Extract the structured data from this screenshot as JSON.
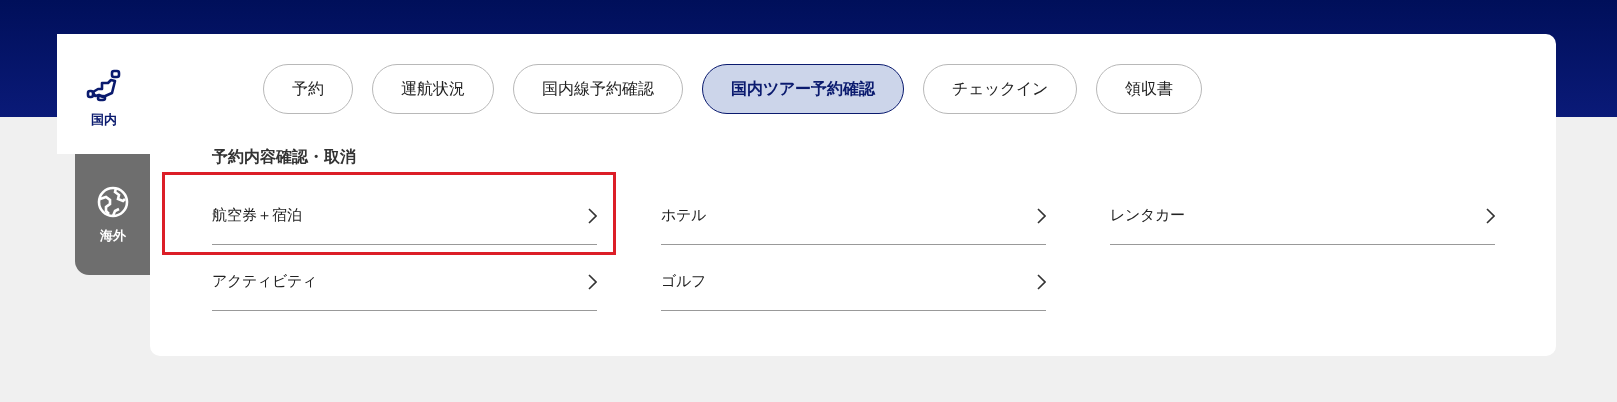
{
  "side_tabs": [
    {
      "label": "国内",
      "kind": "japan",
      "selected": true
    },
    {
      "label": "海外",
      "kind": "globe",
      "selected": false
    }
  ],
  "menu_tabs": [
    {
      "label": "予約",
      "selected": false
    },
    {
      "label": "運航状況",
      "selected": false
    },
    {
      "label": "国内線予約確認",
      "selected": false
    },
    {
      "label": "国内ツアー予約確認",
      "selected": true
    },
    {
      "label": "チェックイン",
      "selected": false
    },
    {
      "label": "領収書",
      "selected": false
    }
  ],
  "section": {
    "heading": "予約内容確認・取消",
    "links": [
      {
        "label": "航空券＋宿泊",
        "highlighted": true
      },
      {
        "label": "ホテル",
        "highlighted": false
      },
      {
        "label": "レンタカー",
        "highlighted": false
      },
      {
        "label": "アクティビティ",
        "highlighted": false
      },
      {
        "label": "ゴルフ",
        "highlighted": false
      }
    ]
  }
}
